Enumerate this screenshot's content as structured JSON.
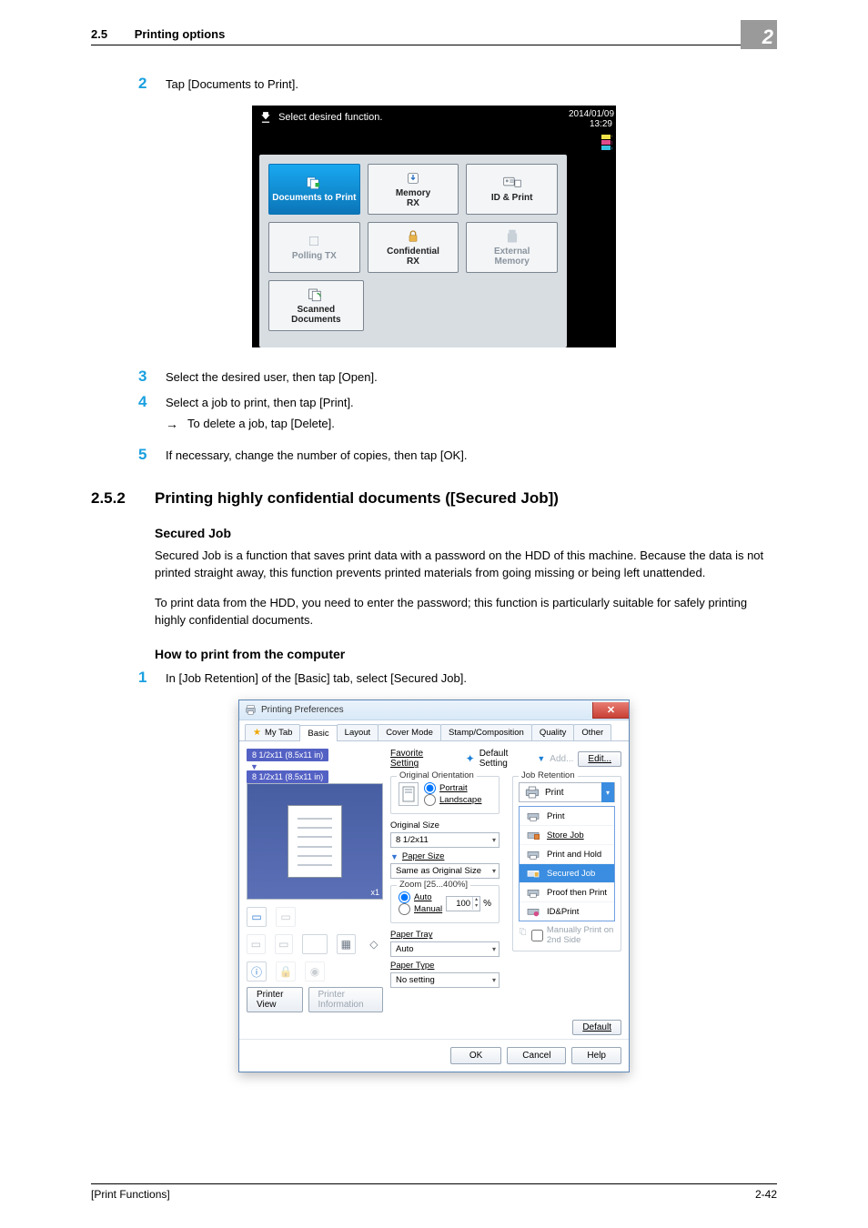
{
  "header": {
    "section_num": "2.5",
    "section_title": "Printing options",
    "chapter_marker": "2"
  },
  "step2": {
    "num": "2",
    "text": "Tap [Documents to Print]."
  },
  "mfp": {
    "header": "Select desired function.",
    "datetime": "2014/01/09 13:29",
    "tiles": {
      "docs_to_print": "Documents to Print",
      "memory_rx_l1": "Memory",
      "memory_rx_l2": "RX",
      "id_print": "ID & Print",
      "polling_tx": "Polling TX",
      "confidential_l1": "Confidential",
      "confidential_l2": "RX",
      "external_l1": "External",
      "external_l2": "Memory",
      "scanned_l1": "Scanned",
      "scanned_l2": "Documents"
    }
  },
  "step3": {
    "num": "3",
    "text": "Select the desired user, then tap [Open]."
  },
  "step4": {
    "num": "4",
    "text": "Select a job to print, then tap [Print].",
    "sub": "To delete a job, tap [Delete]."
  },
  "step5": {
    "num": "5",
    "text": "If necessary, change the number of copies, then tap [OK]."
  },
  "sec252": {
    "num": "2.5.2",
    "title": "Printing highly confidential documents ([Secured Job])",
    "sj_head": "Secured Job",
    "sj_p1": "Secured Job is a function that saves print data with a password on the HDD of this machine. Because the data is not printed straight away, this function prevents printed materials from going missing or being left unattended.",
    "sj_p2": "To print data from the HDD, you need to enter the password; this function is particularly suitable for safely printing highly confidential documents.",
    "howto_head": "How to print from the computer",
    "howto_step1_n": "1",
    "howto_step1_t": "In [Job Retention] of the [Basic] tab, select [Secured Job]."
  },
  "dlg": {
    "title": "Printing Preferences",
    "tabs": {
      "mytab": "My Tab",
      "basic": "Basic",
      "layout": "Layout",
      "cover": "Cover Mode",
      "stamp": "Stamp/Composition",
      "quality": "Quality",
      "other": "Other"
    },
    "left": {
      "size_chip_top": "8 1/2x11 (8.5x11 in)",
      "size_chip_mid": "8 1/2x11 (8.5x11 in)",
      "corner": "x1",
      "btn_printer_view": "Printer View",
      "btn_printer_info": "Printer Information"
    },
    "fs": {
      "label": "Favorite Setting",
      "default": "Default Setting",
      "add": "Add...",
      "edit": "Edit..."
    },
    "orient": {
      "legend": "Original Orientation",
      "portrait": "Portrait",
      "landscape": "Landscape"
    },
    "orig_size": {
      "label": "Original Size",
      "value": "8 1/2x11"
    },
    "paper_size": {
      "label": "Paper Size",
      "value": "Same as Original Size"
    },
    "zoom": {
      "legend": "Zoom [25...400%]",
      "auto": "Auto",
      "manual": "Manual",
      "val": "100",
      "pct": "%"
    },
    "tray": {
      "label": "Paper Tray",
      "value": "Auto"
    },
    "ptype": {
      "label": "Paper Type",
      "value": "No setting"
    },
    "jr": {
      "legend": "Job Retention",
      "selected": "Print",
      "items": {
        "print": "Print",
        "store": "Store Job",
        "print_hold": "Print and Hold",
        "secured": "Secured Job",
        "proof": "Proof then Print",
        "idprint": "ID&Print"
      },
      "foot_label": "Manually Print on 2nd Side"
    },
    "buttons": {
      "default": "Default",
      "ok": "OK",
      "cancel": "Cancel",
      "help": "Help"
    }
  },
  "footer": {
    "left": "[Print Functions]",
    "right": "2-42"
  }
}
